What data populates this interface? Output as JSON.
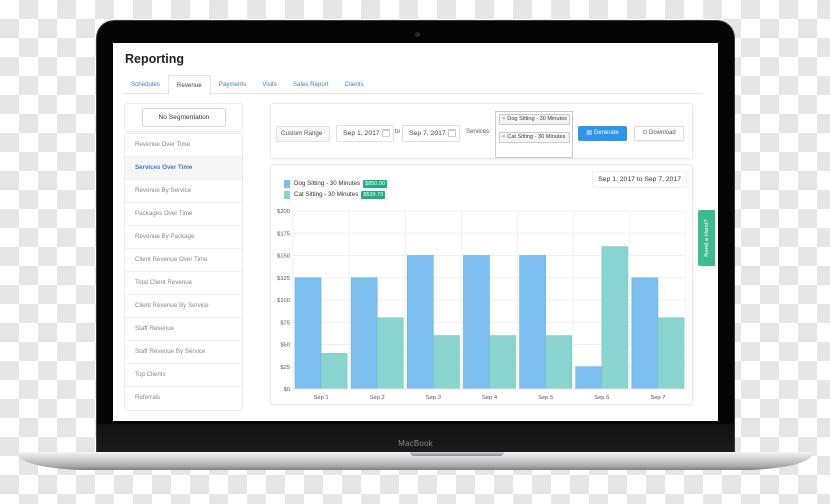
{
  "device": {
    "brand_label": "MacBook"
  },
  "app": {
    "title": "Reporting",
    "tabs": [
      {
        "label": "Schedules",
        "active": false
      },
      {
        "label": "Revenue",
        "active": true
      },
      {
        "label": "Payments",
        "active": false
      },
      {
        "label": "Visits",
        "active": false
      },
      {
        "label": "Sales Report",
        "active": false
      },
      {
        "label": "Clients",
        "active": false
      }
    ]
  },
  "sidebar": {
    "segmentation_value": "No Segmentation",
    "items": [
      {
        "label": "Revenue Over Time",
        "active": false
      },
      {
        "label": "Services Over Time",
        "active": true
      },
      {
        "label": "Revenue By Service",
        "active": false
      },
      {
        "label": "Packages Over Time",
        "active": false
      },
      {
        "label": "Revenue By Package",
        "active": false
      },
      {
        "label": "Client Revenue Over Time",
        "active": false
      },
      {
        "label": "Total Client Revenue",
        "active": false
      },
      {
        "label": "Client Revenue By Service",
        "active": false
      },
      {
        "label": "Staff Revenue",
        "active": false
      },
      {
        "label": "Staff Revenue By Service",
        "active": false
      },
      {
        "label": "Top Clients",
        "active": false
      },
      {
        "label": "Referrals",
        "active": false
      }
    ]
  },
  "filters": {
    "range_type": "Custom Range",
    "start_date": "Sep 1, 2017",
    "to_label": "to",
    "end_date": "Sep 7, 2017",
    "services_label": "Services:",
    "selected_services": [
      "Dog Sitting - 30 Minutes",
      "Cat Sitting - 30 Minutes"
    ],
    "remove_glyph": "×",
    "generate_label": "Generate",
    "download_label": "Download",
    "generate_icon": "▤",
    "download_icon": "⊙",
    "generate_color": "#2f95e8"
  },
  "chart_header": {
    "legend": [
      {
        "name": "Dog Sitting - 30 Minutes",
        "total": "$850.00",
        "color": "#7dbff0"
      },
      {
        "name": "Cat Sitting - 30 Minutes",
        "total": "$539.73",
        "color": "#8ad4cf"
      }
    ],
    "date_range": "Sep 1, 2017 to Sep 7, 2017"
  },
  "help_tab": {
    "label": "Need a Hand?",
    "color": "#3fbb91"
  },
  "chart_data": {
    "type": "bar",
    "title": "",
    "xlabel": "",
    "ylabel": "",
    "categories": [
      "Sep 1",
      "Sep 2",
      "Sep 3",
      "Sep 4",
      "Sep 5",
      "Sep 6",
      "Sep 7"
    ],
    "series": [
      {
        "name": "Dog Sitting - 30 Minutes",
        "values": [
          125,
          125,
          150,
          150,
          150,
          25,
          125
        ],
        "color": "#7dbff0"
      },
      {
        "name": "Cat Sitting - 30 Minutes",
        "values": [
          40,
          80,
          60,
          60,
          60,
          160,
          80
        ],
        "color": "#8ad4cf"
      }
    ],
    "ylim": [
      0,
      200
    ],
    "yticks": [
      0,
      25,
      50,
      75,
      100,
      125,
      150,
      175,
      200
    ],
    "ytick_prefix": "$",
    "grid": true,
    "legend_position": "top-left"
  }
}
